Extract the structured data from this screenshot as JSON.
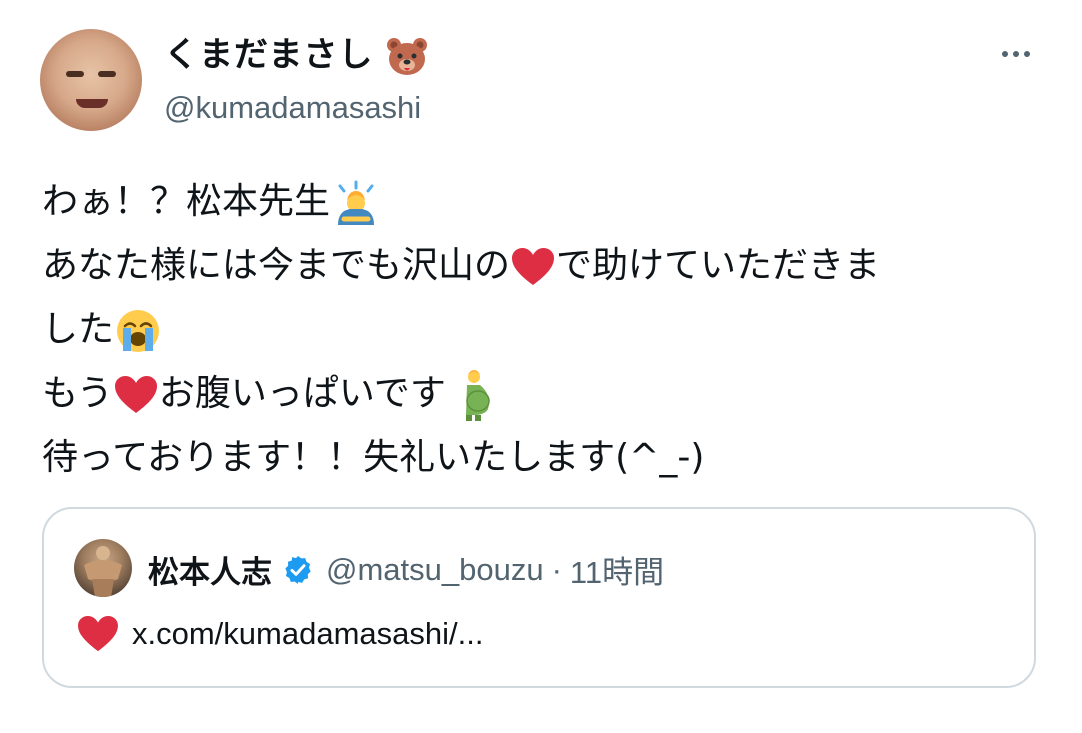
{
  "author": {
    "display_name": "くまだまさし",
    "display_name_emoji": "bear-face-emoji",
    "handle": "@kumadamasashi"
  },
  "tweet": {
    "line1": "わぁ！？松本先生",
    "line1_emoji": "person-bowing-emoji",
    "line2a": "あなた様には今までも沢山の",
    "line2_emoji": "red-heart-emoji",
    "line2b": "で助けていただきま",
    "line3": "した",
    "line3_emoji": "loudly-crying-face-emoji",
    "line4a": "もう",
    "line4_emoji1": "red-heart-emoji",
    "line4b": "お腹いっぱいです",
    "line4_emoji2": "pregnant-man-emoji",
    "line5": "待っております！！失礼いたします(^_-)"
  },
  "quoted": {
    "display_name": "松本人志",
    "handle": "@matsu_bouzu",
    "separator": "·",
    "time": "11時間",
    "body_emoji": "red-heart-emoji",
    "link": "x.com/kumadamasashi/..."
  },
  "colors": {
    "text": "#0f1419",
    "secondary": "#536471",
    "border": "#cfd9de",
    "verified": "#1d9bf0",
    "heart": "#dd2e44"
  }
}
